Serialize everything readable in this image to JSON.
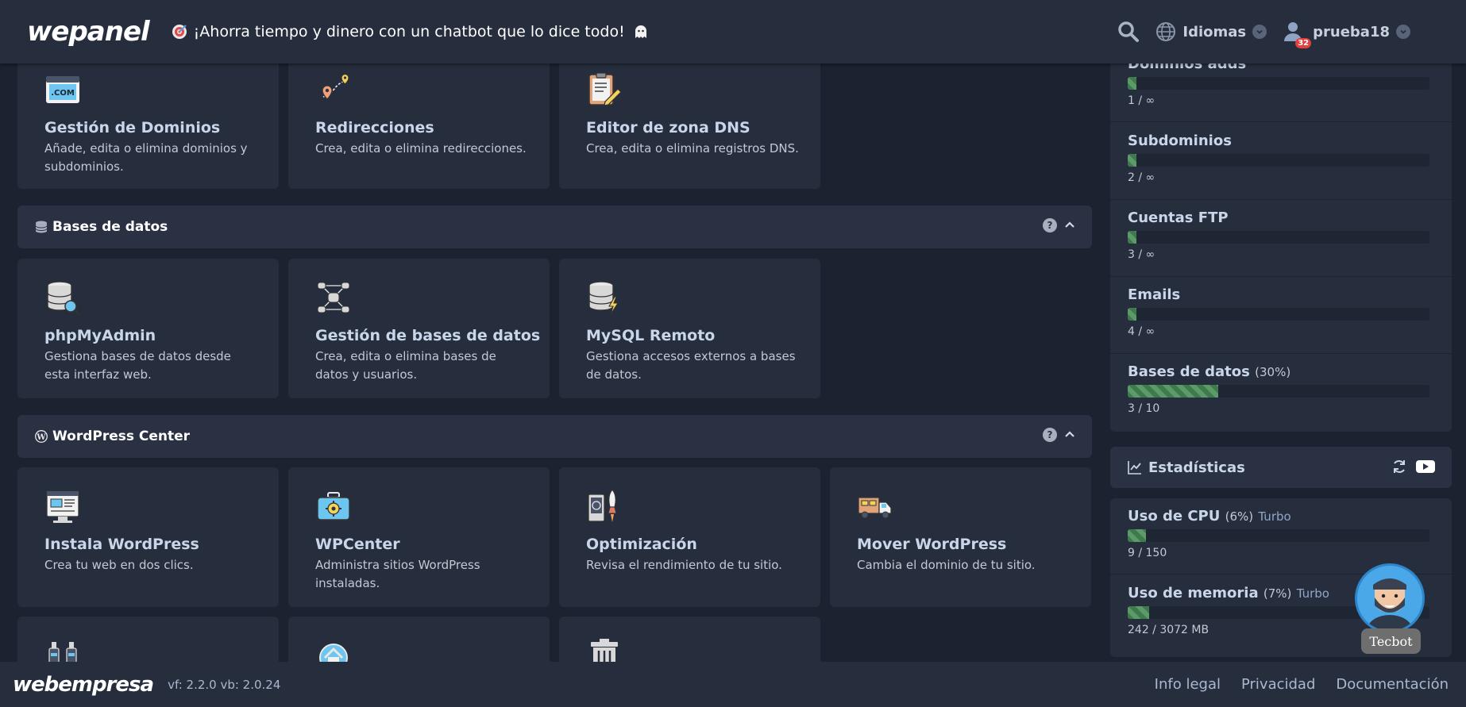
{
  "topbar": {
    "logo": "wepanel",
    "promo_text": "¡Ahorra tiempo y dinero con un chatbot que lo dice todo!",
    "languages_label": "Idiomas",
    "user_name": "prueba18",
    "notification_count": "32"
  },
  "domains_cards": [
    {
      "title": "Gestión de Dominios",
      "desc": "Añade, edita o elimina dominios y subdominios.",
      "icon": "dotcom-icon"
    },
    {
      "title": "Redirecciones",
      "desc": "Crea, edita o elimina redirecciones.",
      "icon": "redirect-pins-icon"
    },
    {
      "title": "Editor de zona DNS",
      "desc": "Crea, edita o elimina registros DNS.",
      "icon": "clipboard-edit-icon"
    }
  ],
  "databases_section": {
    "title": "Bases de datos"
  },
  "database_cards": [
    {
      "title": "phpMyAdmin",
      "desc": "Gestiona bases de datos desde esta interfaz web.",
      "icon": "database-search-icon"
    },
    {
      "title": "Gestión de bases de datos",
      "desc": "Crea, edita o elimina bases de datos y usuarios.",
      "icon": "database-network-icon"
    },
    {
      "title": "MySQL Remoto",
      "desc": "Gestiona accesos externos a bases de datos.",
      "icon": "database-bolt-icon"
    }
  ],
  "wordpress_section": {
    "title": "WordPress Center"
  },
  "wordpress_cards": [
    {
      "title": "Instala WordPress",
      "desc": "Crea tu web en dos clics.",
      "icon": "browser-install-icon"
    },
    {
      "title": "WPCenter",
      "desc": "Administra sitios WordPress instaladas.",
      "icon": "toolbox-gear-icon"
    },
    {
      "title": "Optimización",
      "desc": "Revisa el rendimiento de tu sitio.",
      "icon": "rocket-optimize-icon"
    },
    {
      "title": "Mover WordPress",
      "desc": "Cambia el dominio de tu sitio.",
      "icon": "moving-truck-icon"
    }
  ],
  "resources": [
    {
      "name": "Dominios adds",
      "pct": "",
      "value": "1 / ∞",
      "fill": 0.03
    },
    {
      "name": "Subdominios",
      "pct": "",
      "value": "2 / ∞",
      "fill": 0.03
    },
    {
      "name": "Cuentas FTP",
      "pct": "",
      "value": "3 / ∞",
      "fill": 0.03
    },
    {
      "name": "Emails",
      "pct": "",
      "value": "4 / ∞",
      "fill": 0.03
    },
    {
      "name": "Bases de datos",
      "pct": "(30%)",
      "value": "3 / 10",
      "fill": 0.3
    }
  ],
  "stats_section": {
    "title": "Estadísticas"
  },
  "usage": [
    {
      "name": "Uso de CPU",
      "pct": "(6%)",
      "turbo": "Turbo",
      "value": "9 / 150",
      "fill": 0.06
    },
    {
      "name": "Uso de memoria",
      "pct": "(7%)",
      "turbo": "Turbo",
      "value": "242 / 3072 MB",
      "fill": 0.07
    }
  ],
  "tecbot": {
    "label": "Tecbot"
  },
  "footer": {
    "logo": "webempresa",
    "version": "vf: 2.2.0 vb: 2.0.24",
    "links": [
      "Info legal",
      "Privacidad",
      "Documentación"
    ]
  },
  "colors": {
    "bg": "#1b2230",
    "panel": "#262e3d",
    "header": "#293142",
    "bar_fill": "#4e8a5b",
    "badge": "#e2403c"
  }
}
